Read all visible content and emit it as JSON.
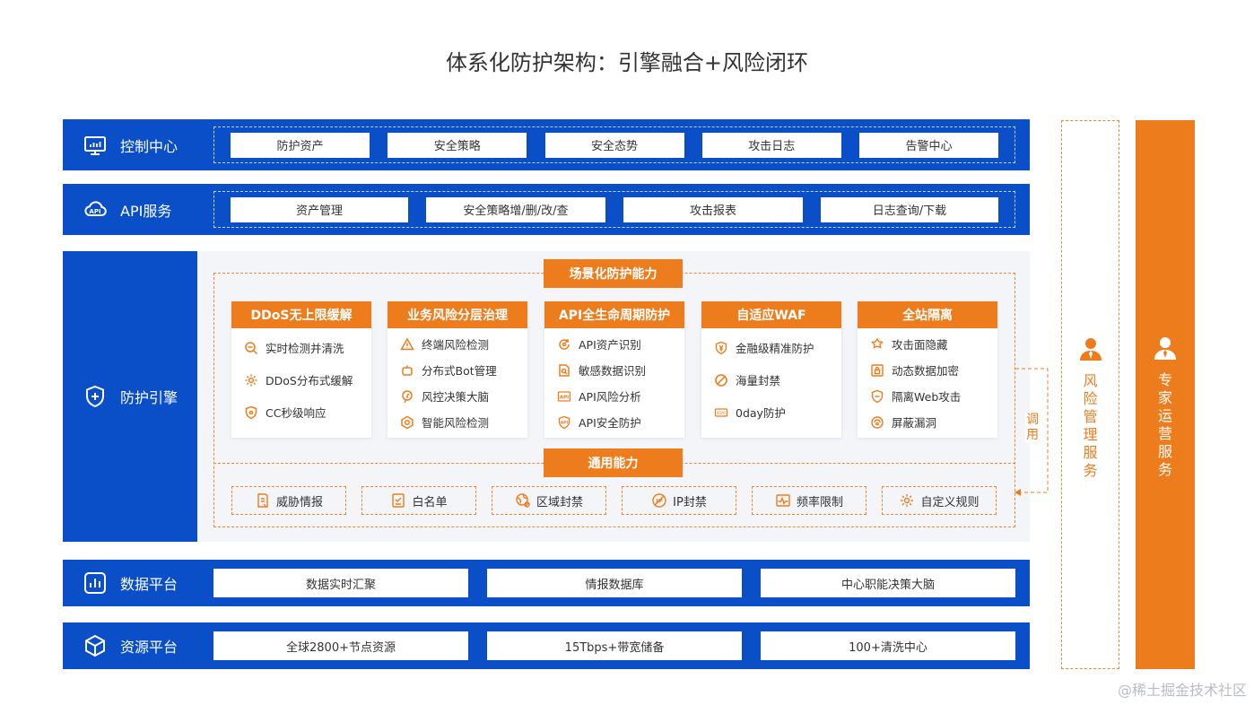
{
  "title": "体系化防护架构：引擎融合+风险闭环",
  "control_center": {
    "label": "控制中心",
    "items": [
      "防护资产",
      "安全策略",
      "安全态势",
      "攻击日志",
      "告警中心"
    ]
  },
  "api_service": {
    "label": "API服务",
    "items": [
      "资产管理",
      "安全策略增/删/改/查",
      "攻击报表",
      "日志查询/下载"
    ]
  },
  "engine": {
    "label": "防护引擎",
    "scenario_tag": "场景化防护能力",
    "general_tag": "通用能力",
    "cards": [
      {
        "title": "DDoS无上限缓解",
        "items": [
          {
            "icon": "search-icon",
            "text": "实时检测并清洗"
          },
          {
            "icon": "gear-icon",
            "text": "DDoS分布式缓解"
          },
          {
            "icon": "shield-icon",
            "text": "CC秒级响应"
          }
        ]
      },
      {
        "title": "业务风险分层治理",
        "items": [
          {
            "icon": "alert-icon",
            "text": "终端风险检测"
          },
          {
            "icon": "bot-icon",
            "text": "分布式Bot管理"
          },
          {
            "icon": "brain-icon",
            "text": "风控决策大脑"
          },
          {
            "icon": "chip-icon",
            "text": "智能风险检测"
          }
        ]
      },
      {
        "title": "API全生命周期防护",
        "items": [
          {
            "icon": "cycle-icon",
            "text": "API资产识别"
          },
          {
            "icon": "doc-search-icon",
            "text": "敏感数据识别"
          },
          {
            "icon": "api-icon",
            "text": "API风险分析"
          },
          {
            "icon": "api-shield-icon",
            "text": "API安全防护"
          }
        ]
      },
      {
        "title": "自适应WAF",
        "items": [
          {
            "icon": "yen-shield-icon",
            "text": "金融级精准防护"
          },
          {
            "icon": "ban-icon",
            "text": "海量封禁"
          },
          {
            "icon": "oday-icon",
            "text": "0day防护"
          }
        ]
      },
      {
        "title": "全站隔离",
        "items": [
          {
            "icon": "hide-icon",
            "text": "攻击面隐藏"
          },
          {
            "icon": "lock-doc-icon",
            "text": "动态数据加密"
          },
          {
            "icon": "isolate-icon",
            "text": "隔离Web攻击"
          },
          {
            "icon": "patch-icon",
            "text": "屏蔽漏洞"
          }
        ]
      }
    ],
    "general": [
      {
        "icon": "intel-icon",
        "text": "威胁情报"
      },
      {
        "icon": "whitelist-icon",
        "text": "白名单"
      },
      {
        "icon": "region-icon",
        "text": "区域封禁"
      },
      {
        "icon": "ip-ban-icon",
        "text": "IP封禁"
      },
      {
        "icon": "rate-icon",
        "text": "频率限制"
      },
      {
        "icon": "custom-rule-icon",
        "text": "自定义规则"
      }
    ]
  },
  "call_label": "调用",
  "data_platform": {
    "label": "数据平台",
    "items": [
      "数据实时汇聚",
      "情报数据库",
      "中心职能决策大脑"
    ]
  },
  "resource_platform": {
    "label": "资源平台",
    "items": [
      "全球2800+节点资源",
      "15Tbps+带宽储备",
      "100+清洗中心"
    ]
  },
  "risk_service": {
    "label": "风险管理服务"
  },
  "expert_service": {
    "label": "专家运营服务"
  },
  "watermark": "@稀土掘金技术社区",
  "colors": {
    "blue": "#0a4fc8",
    "orange": "#ed7c1d"
  }
}
